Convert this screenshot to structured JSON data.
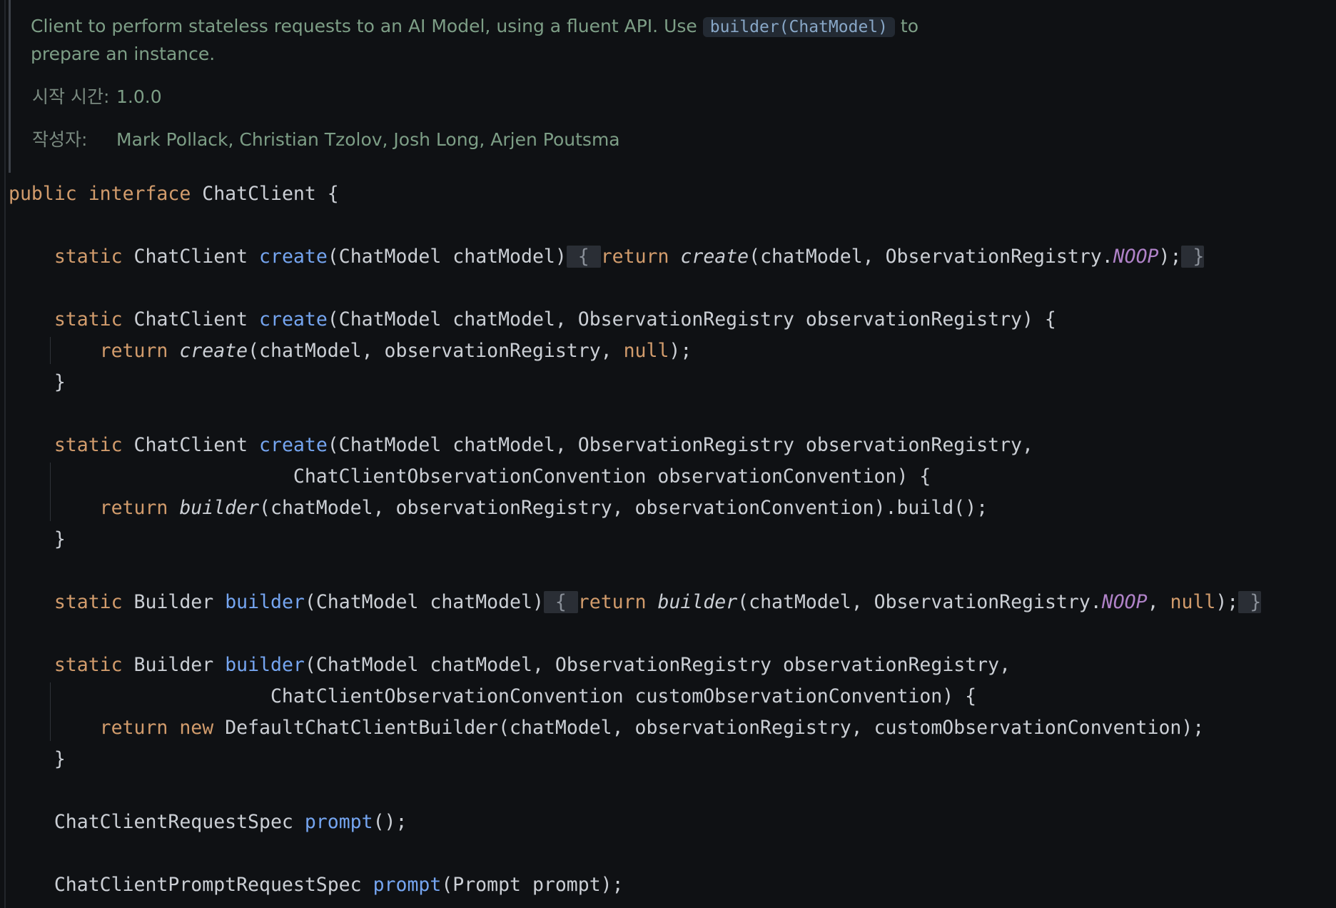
{
  "doc": {
    "desc_before": "Client to perform stateless requests to an AI Model, using a fluent API. Use ",
    "link": "builder(ChatModel)",
    "desc_after": " to prepare an instance.",
    "since_label": "시작 시간:",
    "since_value": "1.0.0",
    "author_label": "작성자:",
    "author_value": "Mark Pollack, Christian Tzolov, Josh Long, Arjen Poutsma"
  },
  "code": {
    "l1": {
      "a": "public",
      "b": "interface",
      "c": "ChatClient {"
    },
    "l2": {
      "a": "static",
      "b": "ChatClient",
      "fn": "create",
      "c": "(ChatModel chatModel)",
      "f1": " { ",
      "kw2": "return",
      "it": "create",
      "d": "(chatModel, ObservationRegistry.",
      "const": "NOOP",
      "e": ");",
      "f2": " }"
    },
    "l3": {
      "a": "static",
      "b": "ChatClient",
      "fn": "create",
      "c": "(ChatModel chatModel, ObservationRegistry observationRegistry) {"
    },
    "l4": {
      "kw": "return",
      "it": "create",
      "c": "(chatModel, observationRegistry, ",
      "null": "null",
      "d": ");"
    },
    "l5": "}",
    "l6": {
      "a": "static",
      "b": "ChatClient",
      "fn": "create",
      "c": "(ChatModel chatModel, ObservationRegistry observationRegistry,"
    },
    "l7": "ChatClientObservationConvention observationConvention) {",
    "l8": {
      "kw": "return",
      "it": "builder",
      "c": "(chatModel, observationRegistry, observationConvention).build();"
    },
    "l9": "}",
    "l10": {
      "a": "static",
      "b": "Builder",
      "fn": "builder",
      "c": "(ChatModel chatModel)",
      "f1": " { ",
      "kw2": "return",
      "it": "builder",
      "d": "(chatModel, ObservationRegistry.",
      "const": "NOOP",
      "e": ", ",
      "null": "null",
      "g": ");",
      "f2": " }"
    },
    "l11": {
      "a": "static",
      "b": "Builder",
      "fn": "builder",
      "c": "(ChatModel chatModel, ObservationRegistry observationRegistry,"
    },
    "l12": "ChatClientObservationConvention customObservationConvention) {",
    "l13": {
      "kw": "return",
      "kw2": "new",
      "c": "DefaultChatClientBuilder(chatModel, observationRegistry, customObservationConvention);"
    },
    "l14": "}",
    "l15": {
      "a": "ChatClientRequestSpec",
      "fn": "prompt",
      "c": "();"
    },
    "l16": {
      "a": "ChatClientPromptRequestSpec",
      "fn": "prompt",
      "c": "(Prompt prompt);"
    }
  }
}
